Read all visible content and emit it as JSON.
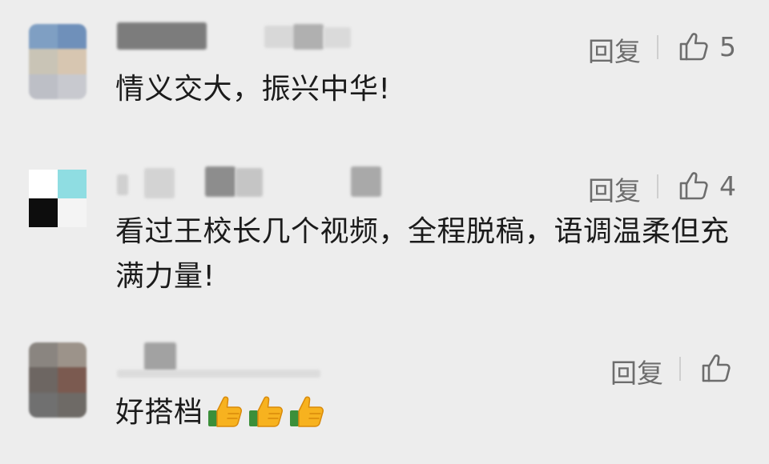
{
  "comments": [
    {
      "text": "情义交大，振兴中华!",
      "reply_label": "回复",
      "like_count": "5"
    },
    {
      "text": "看过王校长几个视频，全程脱稿，语调温柔但充满力量!",
      "reply_label": "回复",
      "like_count": "4"
    },
    {
      "text": "好搭档",
      "reply_label": "回复",
      "like_count": "",
      "emojis": [
        "thumbs-up-emoji",
        "thumbs-up-emoji",
        "thumbs-up-emoji"
      ]
    }
  ],
  "colors": {
    "background": "#ededed",
    "text": "#1b1b1b",
    "meta": "#6d6d6d"
  }
}
